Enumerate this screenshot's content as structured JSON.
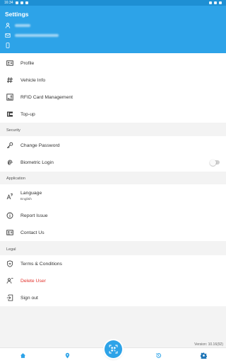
{
  "status_bar": {
    "time": "16:34"
  },
  "header": {
    "title": "Settings",
    "user_icon": "person-icon",
    "email_icon": "envelope-icon",
    "phone_icon": "phone-icon"
  },
  "account_items": [
    {
      "label": "Profile",
      "icon": "id-card-icon"
    },
    {
      "label": "Vehicle Info",
      "icon": "hash-icon"
    },
    {
      "label": "RFID Card Management",
      "icon": "rfid-card-icon"
    },
    {
      "label": "Top-up",
      "icon": "wallet-icon"
    }
  ],
  "security": {
    "heading": "Security",
    "change_password": "Change Password",
    "biometric_login": "Biometric Login",
    "biometric_enabled": false
  },
  "application": {
    "heading": "Application",
    "language_label": "Language",
    "language_value": "English",
    "report_issue": "Report Issue",
    "contact_us": "Contact Us"
  },
  "legal": {
    "heading": "Legal",
    "terms": "Terms & Conditions",
    "delete_user": "Delete User",
    "sign_out": "Sign out"
  },
  "version": "Version: 10.16(92)",
  "colors": {
    "primary": "#2da3e8",
    "danger": "#e2312b"
  },
  "bottom_nav": [
    "home-icon",
    "location-icon",
    "qr-scan-icon",
    "history-icon",
    "settings-icon"
  ]
}
